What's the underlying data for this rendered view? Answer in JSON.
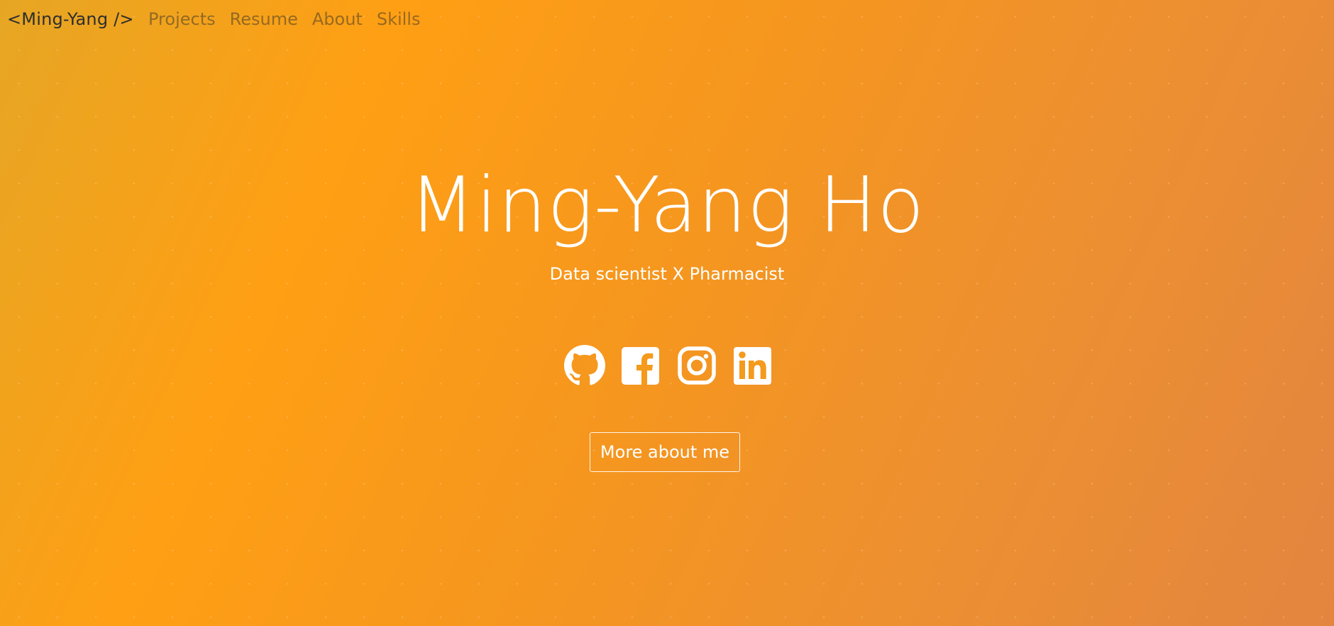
{
  "nav": {
    "brand": "<Ming-Yang />",
    "links": [
      "Projects",
      "Resume",
      "About",
      "Skills"
    ]
  },
  "hero": {
    "title": "Ming-Yang Ho",
    "subtitle": "Data scientist X Pharmacist",
    "button_label": "More about me"
  },
  "social": [
    {
      "icon": "github-icon"
    },
    {
      "icon": "facebook-icon"
    },
    {
      "icon": "instagram-icon"
    },
    {
      "icon": "linkedin-icon"
    }
  ],
  "colors": {
    "background_start": "#e6a624",
    "background_mid": "#ff9f14",
    "background_end": "#e3853f",
    "text": "#ffffff",
    "brand_text": "#2e2e2e"
  }
}
